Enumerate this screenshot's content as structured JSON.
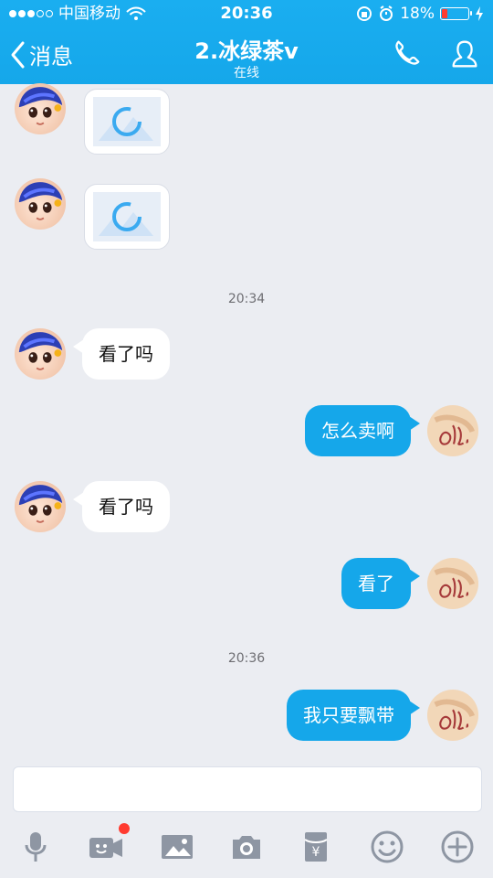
{
  "status_bar": {
    "carrier": "中国移动",
    "time": "20:36",
    "battery_percent": "18%"
  },
  "nav": {
    "back_label": "消息",
    "title": "2.冰绿茶v",
    "subtitle": "在线"
  },
  "timestamps": [
    "20:34",
    "20:36"
  ],
  "messages": [
    {
      "side": "left",
      "type": "image"
    },
    {
      "side": "left",
      "type": "image"
    },
    {
      "side": "left",
      "type": "text",
      "text": "看了吗"
    },
    {
      "side": "right",
      "type": "text",
      "text": "怎么卖啊"
    },
    {
      "side": "left",
      "type": "text",
      "text": "看了吗"
    },
    {
      "side": "right",
      "type": "text",
      "text": "看了"
    },
    {
      "side": "right",
      "type": "text",
      "text": "我只要飘带"
    }
  ],
  "colors": {
    "accent": "#15a7ea",
    "chat_bg": "#ebedf2",
    "notification_dot": "#ff3b30"
  },
  "toolbar": {
    "icons": [
      "microphone-icon",
      "video-call-icon",
      "image-icon",
      "camera-icon",
      "red-packet-icon",
      "emoji-icon",
      "add-icon"
    ]
  }
}
